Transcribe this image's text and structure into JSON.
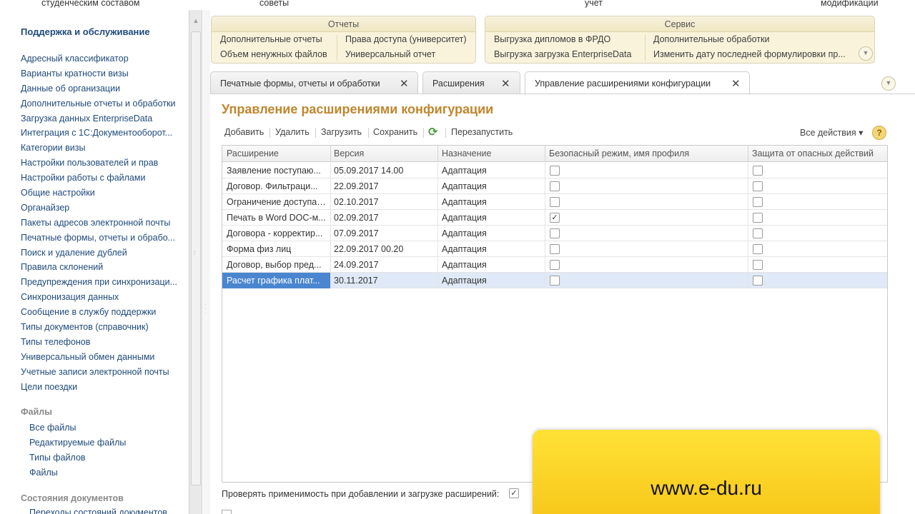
{
  "top_strip": [
    "студенческим составом",
    "советы",
    "учет",
    "модификации"
  ],
  "sidebar": {
    "title": "Поддержка и обслуживание",
    "items": [
      "Адресный классификатор",
      "Варианты кратности визы",
      "Данные об организации",
      "Дополнительные отчеты и обработки",
      "Загрузка данных EnterpriseData",
      "Интеграция с 1С:Документооборот...",
      "Категории визы",
      "Настройки пользователей и прав",
      "Настройки работы с файлами",
      "Общие настройки",
      "Органайзер",
      "Пакеты адресов электронной почты",
      "Печатные формы, отчеты и обрабо...",
      "Поиск и удаление дублей",
      "Правила склонений",
      "Предупреждения при синхронизаци...",
      "Синхронизация данных",
      "Сообщение в службу поддержки",
      "Типы документов (справочник)",
      "Типы телефонов",
      "Универсальный обмен данными",
      "Учетные записи электронной почты",
      "Цели поездки"
    ],
    "files_group": {
      "label": "Файлы",
      "items": [
        "Все файлы",
        "Редактируемые файлы",
        "Типы файлов",
        "Файлы"
      ]
    },
    "states_group": {
      "label": "Состояния документов",
      "items": [
        "Переходы состояний документов"
      ]
    }
  },
  "reports_group": {
    "label": "Отчеты",
    "col1": [
      "Дополнительные отчеты",
      "Объем ненужных файлов"
    ],
    "col2": [
      "Права доступа (университет)",
      "Универсальный отчет"
    ]
  },
  "service_group": {
    "label": "Сервис",
    "col1": [
      "Выгрузка дипломов в ФРДО",
      "Выгрузка загрузка EnterpriseData"
    ],
    "col2": [
      "Дополнительные обработки",
      "Изменить дату последней формулировки пр..."
    ]
  },
  "tabs": [
    {
      "label": "Печатные формы, отчеты и обработки"
    },
    {
      "label": "Расширения"
    },
    {
      "label": "Управление расширениями конфигурации"
    }
  ],
  "form": {
    "title": "Управление расширениями конфигурации",
    "toolbar": {
      "add": "Добавить",
      "delete": "Удалить",
      "load": "Загрузить",
      "save": "Сохранить",
      "restart": "Перезапустить",
      "all_actions": "Все действия ▾",
      "help": "?"
    },
    "columns": [
      "Расширение",
      "Версия",
      "Назначение",
      "Безопасный режим, имя профиля",
      "Защита от опасных действий"
    ],
    "rows": [
      {
        "name": "Заявление поступаю...",
        "version": "05.09.2017 14.00",
        "purpose": "Адаптация",
        "safe": false,
        "protect": false
      },
      {
        "name": "Договор. Фильтраци...",
        "version": "22.09.2017",
        "purpose": "Адаптация",
        "safe": false,
        "protect": false
      },
      {
        "name": "Ограничение доступа ...",
        "version": "02.10.2017",
        "purpose": "Адаптация",
        "safe": false,
        "protect": false
      },
      {
        "name": "Печать в Word DOC-м...",
        "version": "02.09.2017",
        "purpose": "Адаптация",
        "safe": true,
        "protect": false
      },
      {
        "name": "Договора - корректир...",
        "version": "07.09.2017",
        "purpose": "Адаптация",
        "safe": false,
        "protect": false
      },
      {
        "name": "Форма физ лиц",
        "version": "22.09.2017 00.20",
        "purpose": "Адаптация",
        "safe": false,
        "protect": false
      },
      {
        "name": "Договор, выбор пред...",
        "version": "24.09.2017",
        "purpose": "Адаптация",
        "safe": false,
        "protect": false
      },
      {
        "name": "Расчет графика плат...",
        "version": "30.11.2017",
        "purpose": "Адаптация",
        "safe": false,
        "protect": false
      }
    ],
    "selected_row": 7,
    "check_applicability_label": "Проверять применимость при добавлении и загрузке расширений:",
    "check_applicability_value": true
  },
  "banner": {
    "text": "www.e-du.ru"
  },
  "colors": {
    "title": "#c1862d",
    "link": "#1f4a7c",
    "selection": "#4a86cf",
    "banner": "#f7c61a"
  }
}
